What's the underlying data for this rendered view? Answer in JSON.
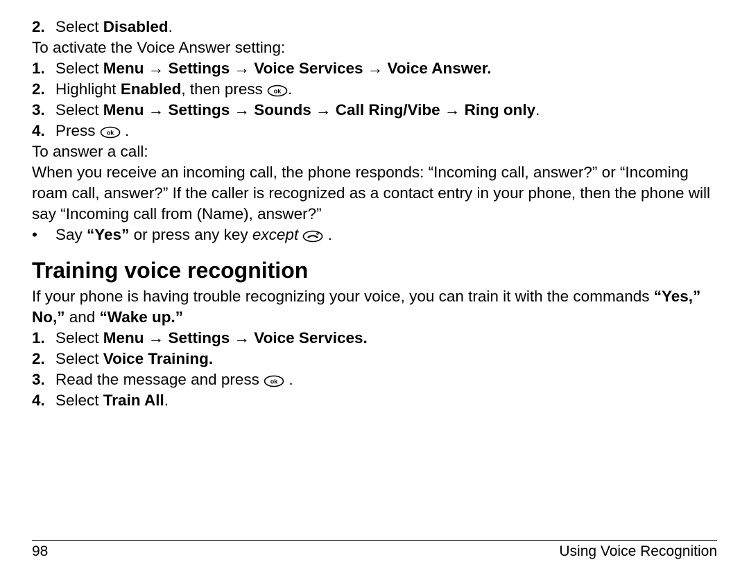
{
  "steps_top": {
    "step2_prefix": "Select ",
    "step2_bold": "Disabled",
    "num2": "2."
  },
  "activate_intro": "To activate the Voice Answer setting:",
  "activate_steps": {
    "s1_num": "1.",
    "s1_prefix": "Select ",
    "s1_bold": "Menu → Settings → Voice Services → Voice Answer.",
    "s2_num": "2.",
    "s2_prefix": "Highlight ",
    "s2_bold": "Enabled",
    "s2_mid": ", then press ",
    "s2_aftericon": ".",
    "s3_num": "3.",
    "s3_prefix": "Select ",
    "s3_bold": "Menu → Settings → Sounds → Call Ring/Vibe → Ring only",
    "s3_after": ".",
    "s4_num": "4.",
    "s4_prefix": "Press ",
    "s4_aftericon": " ."
  },
  "answer_intro": "To answer a call:",
  "answer_body": "When you receive an incoming call, the phone responds: “Incoming call, answer?” or “Incoming roam call, answer?” If the caller is recognized as a contact entry in your phone, then the phone will say “Incoming call from (Name), answer?”",
  "say_yes": {
    "bullet": "•",
    "prefix": "Say ",
    "bold": "“Yes”",
    "mid": " or press any key ",
    "ital": "except",
    "aftericon": " ."
  },
  "heading": "Training voice recognition",
  "train_intro_pre": "If your phone is having trouble recognizing your voice, you can train it with the commands ",
  "train_intro_bold1": "“Yes,” No,”",
  "train_intro_mid": " and ",
  "train_intro_bold2": "“Wake up.”",
  "train_steps": {
    "s1_num": "1.",
    "s1_prefix": "Select ",
    "s1_bold": "Menu → Settings → Voice Services.",
    "s2_num": "2.",
    "s2_prefix": "Select ",
    "s2_bold": "Voice Training.",
    "s3_num": "3.",
    "s3_prefix": "Read the message and press ",
    "s3_aftericon": " .",
    "s4_num": "4.",
    "s4_prefix": "Select ",
    "s4_bold": "Train All",
    "s4_after": "."
  },
  "footer": {
    "page_num": "98",
    "section": "Using Voice Recognition"
  }
}
